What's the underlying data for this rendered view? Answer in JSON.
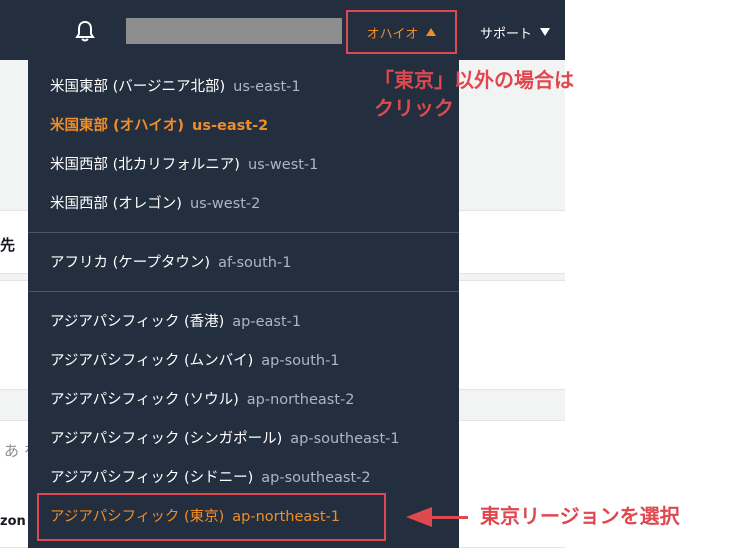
{
  "topbar": {
    "region_label": "オハイオ",
    "support_label": "サポート"
  },
  "background": {
    "frag1": "先",
    "frag2": "あ を",
    "frag3": "zon"
  },
  "dropdown": {
    "items": [
      {
        "name": "米国東部 (バージニア北部)",
        "code": "us-east-1"
      },
      {
        "name": "米国東部 (オハイオ)",
        "code": "us-east-2"
      },
      {
        "name": "米国西部 (北カリフォルニア)",
        "code": "us-west-1"
      },
      {
        "name": "米国西部 (オレゴン)",
        "code": "us-west-2"
      },
      {
        "name": "アフリカ (ケープタウン)",
        "code": "af-south-1"
      },
      {
        "name": "アジアパシフィック (香港)",
        "code": "ap-east-1"
      },
      {
        "name": "アジアパシフィック (ムンバイ)",
        "code": "ap-south-1"
      },
      {
        "name": "アジアパシフィック (ソウル)",
        "code": "ap-northeast-2"
      },
      {
        "name": "アジアパシフィック (シンガポール)",
        "code": "ap-southeast-1"
      },
      {
        "name": "アジアパシフィック (シドニー)",
        "code": "ap-southeast-2"
      },
      {
        "name": "アジアパシフィック (東京)",
        "code": "ap-northeast-1"
      }
    ]
  },
  "annotations": {
    "note_top_line1": "「東京」以外の場合は",
    "note_top_line2": "クリック",
    "note_bottom": "東京リージョンを選択"
  },
  "colors": {
    "accent_orange": "#f08c2a",
    "annotation_red": "#e0484f",
    "navbar": "#232f3e"
  }
}
